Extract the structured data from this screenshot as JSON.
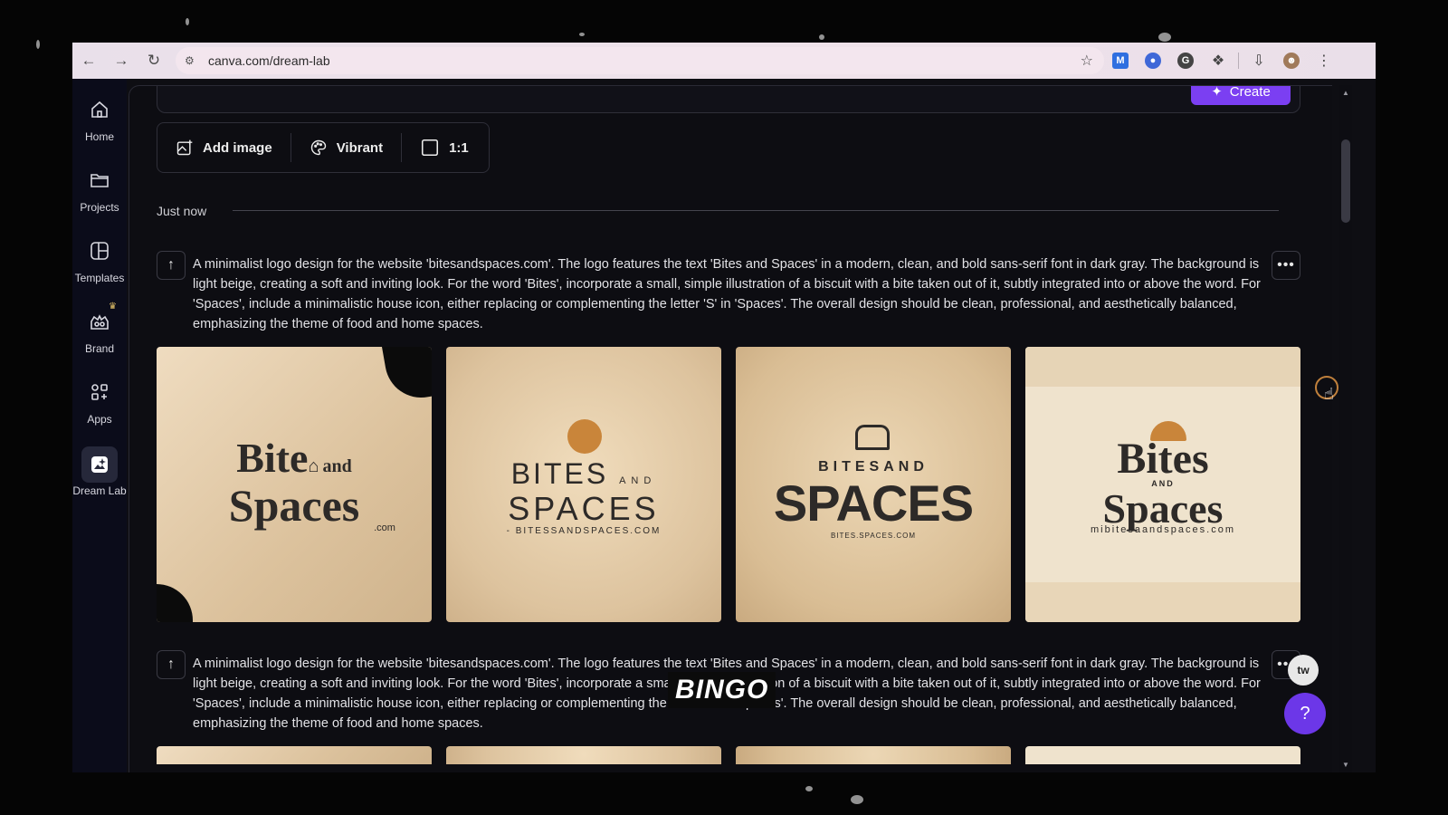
{
  "browser": {
    "url": "canva.com/dream-lab",
    "nav": {
      "back_icon": "back-arrow-icon",
      "forward_icon": "forward-arrow-icon",
      "reload_icon": "reload-icon"
    }
  },
  "sidebar": {
    "items": [
      {
        "label": "Home",
        "icon": "home-icon"
      },
      {
        "label": "Projects",
        "icon": "folder-icon"
      },
      {
        "label": "Templates",
        "icon": "templates-icon"
      },
      {
        "label": "Brand",
        "icon": "brand-icon"
      },
      {
        "label": "Apps",
        "icon": "apps-icon"
      },
      {
        "label": "Dream Lab",
        "icon": "dream-lab-icon",
        "active": true
      }
    ]
  },
  "toolbar": {
    "create_label": "Create",
    "options": [
      {
        "label": "Add image",
        "icon": "image-add-icon"
      },
      {
        "label": "Vibrant",
        "icon": "palette-icon"
      },
      {
        "label": "1:1",
        "icon": "square-ratio-icon"
      }
    ]
  },
  "history": {
    "section_label": "Just now",
    "prompts": [
      {
        "text": "A minimalist logo design for the website 'bitesandspaces.com'. The logo features the text 'Bites and Spaces' in a modern, clean, and bold sans-serif font in dark gray. The background is light beige, creating a soft and inviting look. For the word 'Bites', incorporate a small, simple illustration of a biscuit with a bite taken out of it, subtly integrated into or above the word. For 'Spaces', include a minimalistic house icon, either replacing or complementing the letter 'S' in 'Spaces'. The overall design should be clean, professional, and aesthetically balanced, emphasizing the theme of food and home spaces.",
        "images": [
          {
            "line1": "Bite",
            "and": "and",
            "line2": "Spaces",
            "sub": ".com"
          },
          {
            "line1": "BITES",
            "and": "AND",
            "line2": "SPACES",
            "sub": "- BITESSANDSPACES.COM"
          },
          {
            "line1": "BITESAND",
            "line2": "SPACES",
            "sub": "BITES.SPACES.COM"
          },
          {
            "line1": "Bites",
            "and": "AND",
            "line2": "Spaces",
            "sub": "mibitesaandspaces.com"
          }
        ]
      },
      {
        "text": "A minimalist logo design for the website 'bitesandspaces.com'. The logo features the text 'Bites and Spaces' in a modern, clean, and bold sans-serif font in dark gray. The background is light beige, creating a soft and inviting look. For the word 'Bites', incorporate a small, simple illustration of a biscuit with a bite taken out of it, subtly integrated into or above the word. For 'Spaces', include a minimalistic house icon, either replacing or complementing the letter 'S' in 'Spaces'. The overall design should be clean, professional, and aesthetically balanced, emphasizing the theme of food and home spaces."
      }
    ]
  },
  "overlay": {
    "word": "BINGO",
    "mascot": "tw",
    "help": "?"
  },
  "colors": {
    "accent": "#7b3ff2",
    "help": "#6c37e8",
    "background": "#0d0d12"
  }
}
